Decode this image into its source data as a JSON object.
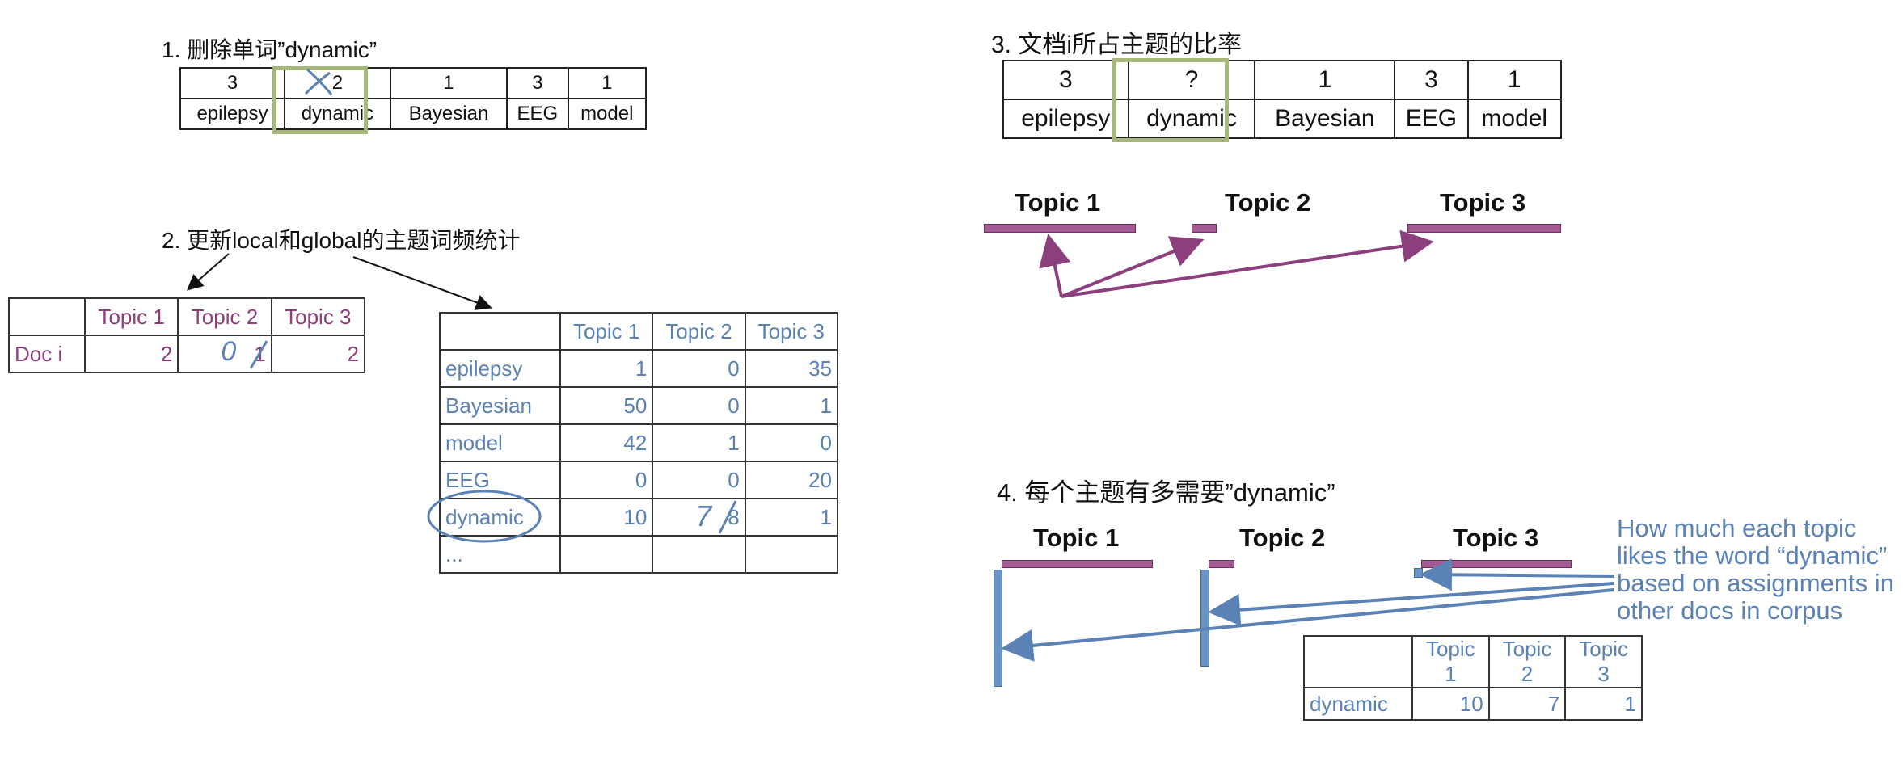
{
  "step1": {
    "number": "1.",
    "title": "删除单词”dynamic”",
    "counts": [
      "3",
      "2",
      "1",
      "3",
      "1"
    ],
    "words": [
      "epilepsy",
      "dynamic",
      "Bayesian",
      "EEG",
      "model"
    ]
  },
  "step2": {
    "number": "2.",
    "title": "更新local和global的主题词频统计",
    "local_table": {
      "headers": [
        "",
        "Topic 1",
        "Topic 2",
        "Topic 3"
      ],
      "row_label": "Doc i",
      "values": [
        "2",
        "",
        "2"
      ],
      "topic2_new": "0",
      "topic2_old": "1"
    },
    "global_table": {
      "headers": [
        "",
        "Topic 1",
        "Topic 2",
        "Topic 3"
      ],
      "rows": [
        {
          "word": "epilepsy",
          "t1": "1",
          "t2": "0",
          "t3": "35"
        },
        {
          "word": "Bayesian",
          "t1": "50",
          "t2": "0",
          "t3": "1"
        },
        {
          "word": "model",
          "t1": "42",
          "t2": "1",
          "t3": "0"
        },
        {
          "word": "EEG",
          "t1": "0",
          "t2": "0",
          "t3": "20"
        },
        {
          "word": "dynamic",
          "t1": "10",
          "t2": "",
          "t3": "1"
        },
        {
          "word": "...",
          "t1": "",
          "t2": "",
          "t3": ""
        }
      ],
      "dynamic_t2_new": "7",
      "dynamic_t2_old": "8"
    }
  },
  "step3": {
    "number": "3.",
    "title": "文档i所占主题的比率",
    "counts": [
      "3",
      "?",
      "1",
      "3",
      "1"
    ],
    "words": [
      "epilepsy",
      "dynamic",
      "Bayesian",
      "EEG",
      "model"
    ],
    "topics": [
      "Topic 1",
      "Topic 2",
      "Topic 3"
    ]
  },
  "step4": {
    "number": "4.",
    "title": "每个主题有多需要”dynamic”",
    "topics": [
      "Topic 1",
      "Topic 2",
      "Topic 3"
    ],
    "note": "How much each topic likes the word “dynamic” based on assignments in other docs in corpus",
    "table": {
      "headers": [
        "",
        "Topic 1",
        "Topic 2",
        "Topic 3"
      ],
      "row_label": "dynamic",
      "values": [
        "10",
        "7",
        "1"
      ]
    }
  },
  "colors": {
    "purple": "#8c3f7d",
    "blue": "#5b82b5",
    "highlight": "#a6b97a",
    "bar_purple": "#a35a93",
    "bar_blue": "#6b94c2"
  }
}
